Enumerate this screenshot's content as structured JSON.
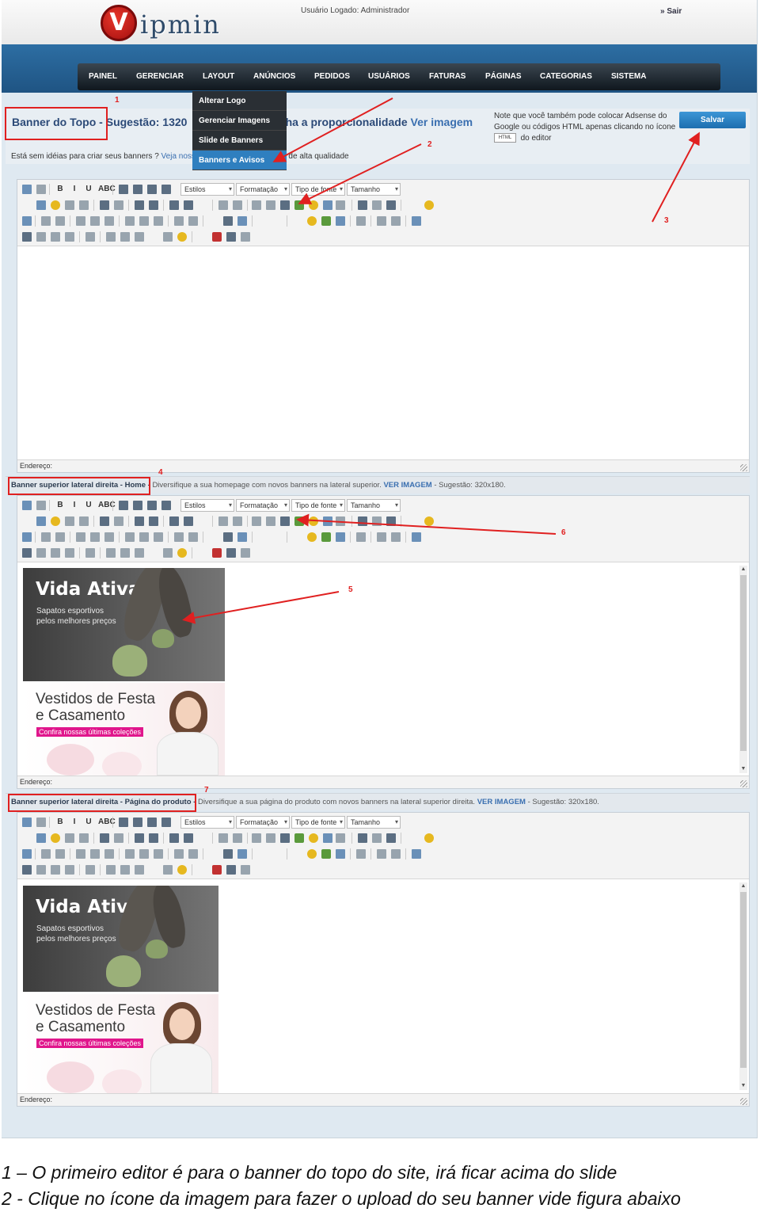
{
  "header": {
    "logo_letter": "V",
    "logo_text": "ipmin",
    "logged_user": "Usuário Logado: Administrador",
    "logout": "» Sair"
  },
  "nav": {
    "items": [
      "PAINEL",
      "GERENCIAR",
      "LAYOUT",
      "ANÚNCIOS",
      "PEDIDOS",
      "USUÁRIOS",
      "FATURAS",
      "PÁGINAS",
      "CATEGORIAS",
      "SISTEMA"
    ],
    "active": "LAYOUT"
  },
  "layout_menu": {
    "items": [
      "Alterar Logo",
      "Gerenciar Imagens",
      "Slide de Banners",
      "Banners e Avisos"
    ],
    "selected": "Banners e Avisos"
  },
  "top_banner": {
    "title_part1": "Banner do Topo -",
    "title_part2": "Sugestão: 1320",
    "title_hidden_tail": "enha a proporcionalidade",
    "title_link": "Ver imagem",
    "tip_start": "Está sem idéias para criar seus banners ?",
    "tip_link": "Veja nossc",
    "tip_end": "ners profissionais e de alta qualidade",
    "note_line1": "Note que você também pode colocar Adsense do",
    "note_line2": "Google ou códigos HTML apenas clicando no ícone",
    "note_icon": "HTML",
    "note_line3": "do editor",
    "save_label": "Salvar"
  },
  "toolbar": {
    "styles": "Estilos",
    "format": "Formatação",
    "font": "Tipo de fonte",
    "size": "Tamanho",
    "bold": "B",
    "italic": "I",
    "underline": "U",
    "strike": "ABC",
    "html": "HTML"
  },
  "editor_footer": "Endereço:",
  "section_home": {
    "label": "Banner superior lateral direita - Home -",
    "desc": "Diversifique a sua homepage com novos banners na lateral superior.",
    "link": "VER IMAGEM",
    "suggestion": "- Sugestão: 320x180."
  },
  "section_product": {
    "label": "Banner superior lateral direita - Página do produto -",
    "desc": "Diversifique a sua página do produto com novos banners na lateral superior direita.",
    "link": "VER IMAGEM",
    "suggestion": "- Sugestão: 320x180."
  },
  "banners": {
    "sport_title": "Vida Ativa",
    "sport_sub": "Sapatos esportivos pelos melhores preços",
    "dress_title_1": "Vestidos de Festa",
    "dress_title_2": "e Casamento",
    "dress_promo": "Confira nossas últimas coleções"
  },
  "annotations": [
    "1",
    "2",
    "3",
    "4",
    "5",
    "6",
    "7"
  ],
  "captions": [
    "1 – O primeiro editor é para o banner do topo do site, irá ficar acima do slide",
    "2 -  Clique no ícone da imagem para fazer o upload do seu banner  vide figura abaixo"
  ],
  "colors": {
    "accent": "#2f7fbf",
    "nav_band": "#1f5483",
    "annotation": "#e02020",
    "promo": "#e0168c"
  }
}
